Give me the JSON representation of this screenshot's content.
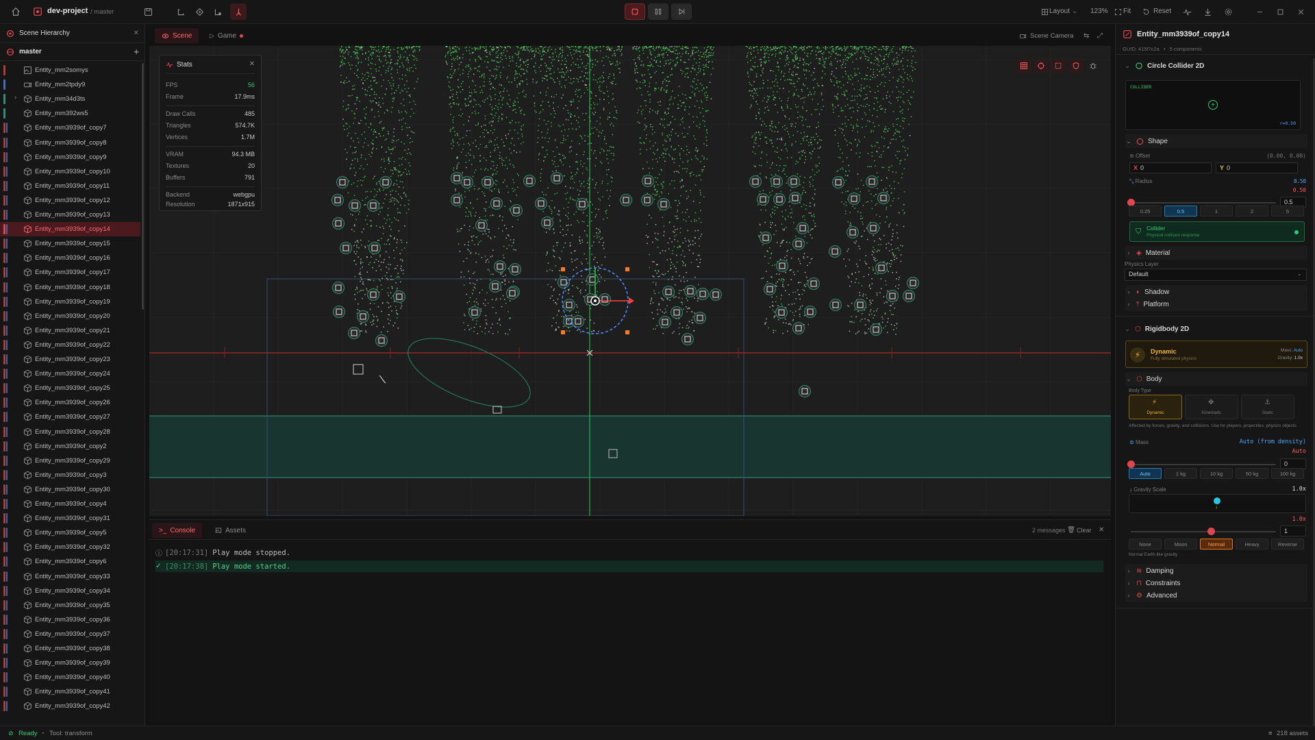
{
  "app": {
    "project": "dev-project",
    "branch": "/ master"
  },
  "toolbar": {
    "layout_label": "Layout",
    "zoom": "123%",
    "fit_label": "Fit",
    "reset_label": "Reset"
  },
  "hierarchy": {
    "title": "Scene Hierarchy",
    "root": "master",
    "items": [
      {
        "label": "Entity_mm2somys",
        "bar": "#b03a3a"
      },
      {
        "label": "Entity_mm2tpdy9",
        "bar": "#4a6fb0"
      },
      {
        "label": "Entity_mm34d3ts",
        "bar": "#2f8f7a"
      },
      {
        "label": "Entity_mm392ws5",
        "bar": "#2f8f7a"
      },
      {
        "label": "Entity_mm3939of_copy7",
        "bar": "#b03a3a"
      },
      {
        "label": "Entity_mm3939of_copy8",
        "bar": "#b03a3a"
      },
      {
        "label": "Entity_mm3939of_copy9",
        "bar": "#b03a3a"
      },
      {
        "label": "Entity_mm3939of_copy10",
        "bar": "#b03a3a"
      },
      {
        "label": "Entity_mm3939of_copy11",
        "bar": "#b03a3a"
      },
      {
        "label": "Entity_mm3939of_copy12",
        "bar": "#b03a3a"
      },
      {
        "label": "Entity_mm3939of_copy13",
        "bar": "#b03a3a"
      },
      {
        "label": "Entity_mm3939of_copy14",
        "bar": "#e0474c"
      },
      {
        "label": "Entity_mm3939of_copy15",
        "bar": "#b03a3a"
      },
      {
        "label": "Entity_mm3939of_copy16",
        "bar": "#b03a3a"
      },
      {
        "label": "Entity_mm3939of_copy17",
        "bar": "#b03a3a"
      },
      {
        "label": "Entity_mm3939of_copy18",
        "bar": "#b03a3a"
      },
      {
        "label": "Entity_mm3939of_copy19",
        "bar": "#b03a3a"
      },
      {
        "label": "Entity_mm3939of_copy20",
        "bar": "#b03a3a"
      },
      {
        "label": "Entity_mm3939of_copy21",
        "bar": "#b03a3a"
      },
      {
        "label": "Entity_mm3939of_copy22",
        "bar": "#b03a3a"
      },
      {
        "label": "Entity_mm3939of_copy23",
        "bar": "#b03a3a"
      },
      {
        "label": "Entity_mm3939of_copy24",
        "bar": "#b03a3a"
      },
      {
        "label": "Entity_mm3939of_copy25",
        "bar": "#b03a3a"
      },
      {
        "label": "Entity_mm3939of_copy26",
        "bar": "#b03a3a"
      },
      {
        "label": "Entity_mm3939of_copy27",
        "bar": "#b03a3a"
      },
      {
        "label": "Entity_mm3939of_copy28",
        "bar": "#b03a3a"
      },
      {
        "label": "Entity_mm3939of_copy2",
        "bar": "#b03a3a"
      },
      {
        "label": "Entity_mm3939of_copy29",
        "bar": "#b03a3a"
      },
      {
        "label": "Entity_mm3939of_copy3",
        "bar": "#b03a3a"
      },
      {
        "label": "Entity_mm3939of_copy30",
        "bar": "#b03a3a"
      },
      {
        "label": "Entity_mm3939of_copy4",
        "bar": "#b03a3a"
      },
      {
        "label": "Entity_mm3939of_copy31",
        "bar": "#b03a3a"
      },
      {
        "label": "Entity_mm3939of_copy5",
        "bar": "#b03a3a"
      },
      {
        "label": "Entity_mm3939of_copy32",
        "bar": "#b03a3a"
      },
      {
        "label": "Entity_mm3939of_copy6",
        "bar": "#b03a3a"
      },
      {
        "label": "Entity_mm3939of_copy33",
        "bar": "#b03a3a"
      },
      {
        "label": "Entity_mm3939of_copy34",
        "bar": "#b03a3a"
      },
      {
        "label": "Entity_mm3939of_copy35",
        "bar": "#b03a3a"
      },
      {
        "label": "Entity_mm3939of_copy36",
        "bar": "#b03a3a"
      },
      {
        "label": "Entity_mm3939of_copy37",
        "bar": "#b03a3a"
      },
      {
        "label": "Entity_mm3939of_copy38",
        "bar": "#b03a3a"
      },
      {
        "label": "Entity_mm3939of_copy39",
        "bar": "#b03a3a"
      },
      {
        "label": "Entity_mm3939of_copy40",
        "bar": "#b03a3a"
      },
      {
        "label": "Entity_mm3939of_copy41",
        "bar": "#b03a3a"
      },
      {
        "label": "Entity_mm3939of_copy42",
        "bar": "#b03a3a"
      }
    ]
  },
  "tabs": {
    "scene": "Scene",
    "game": "Game",
    "scene_camera": "Scene Camera"
  },
  "stats": {
    "title": "Stats",
    "rows": [
      {
        "label": "FPS",
        "value": "56"
      },
      {
        "label": "Frame",
        "value": "17.9ms"
      },
      {
        "label": "Draw Calls",
        "value": "485"
      },
      {
        "label": "Triangles",
        "value": "574.7K"
      },
      {
        "label": "Vertices",
        "value": "1.7M"
      },
      {
        "label": "VRAM",
        "value": "94.3 MB"
      },
      {
        "label": "Textures",
        "value": "20"
      },
      {
        "label": "Buffers",
        "value": "791"
      },
      {
        "label": "Backend",
        "value": "webgpu"
      },
      {
        "label": "Resolution",
        "value": "1871x915"
      }
    ]
  },
  "console": {
    "tab_console": "Console",
    "tab_assets": "Assets",
    "message_count": "2 messages",
    "clear_label": "Clear",
    "logs": [
      {
        "time": "[20:17:31]",
        "text": "Play mode stopped."
      },
      {
        "time": "[20:17:38]",
        "text": "Play mode started."
      }
    ]
  },
  "inspector": {
    "entity_name": "Entity_mm3939of_copy14",
    "guid": "GUID: 415f7c2a",
    "component_count": "5 components",
    "circle_collider": {
      "title": "Circle Collider 2D",
      "preview_label": "COLLIDER",
      "preview_radius": "r=0.50",
      "shape_label": "Shape",
      "offset_label": "Offset",
      "offset_value": "(0.00, 0.00)",
      "x_value": "0",
      "y_value": "0",
      "radius_label": "Radius",
      "radius_value": "0.50",
      "radius_badge": "0.50",
      "radius_input": "0.5",
      "radius_fraction": 0.0,
      "presets": [
        "0.25",
        "0.5",
        "1",
        "2",
        "5"
      ],
      "collider_title": "Collider",
      "collider_sub": "Physical collision response",
      "material_label": "Material",
      "physics_layer_label": "Physics Layer",
      "physics_layer_value": "Default",
      "shadow_label": "Shadow",
      "platform_label": "Platform"
    },
    "rigidbody": {
      "title": "Rigidbody 2D",
      "dynamic_title": "Dynamic",
      "dynamic_sub": "Fully simulated physics",
      "mass_key": "Mass:",
      "mass_val": "Auto",
      "gravity_key": "Gravity:",
      "gravity_val": "1.0x",
      "body_label": "Body",
      "body_type_label": "Body Type",
      "body_types": [
        "Dynamic",
        "Kinematic",
        "Static"
      ],
      "body_desc": "Affected by forces, gravity, and collisions. Use for players, projectiles, physics objects",
      "mass_label": "Mass",
      "mass_value": "Auto (from density)",
      "mass_badge": "Auto",
      "mass_input": "0",
      "mass_fraction": 0.0,
      "mass_presets": [
        "Auto",
        "1 kg",
        "10 kg",
        "50 kg",
        "100 kg"
      ],
      "gravity_scale_label": "Gravity Scale",
      "gravity_scale_value": "1.0x",
      "gravity_badge": "1.0x",
      "gravity_input": "1",
      "gravity_fraction": 0.55,
      "gravity_presets": [
        "None",
        "Moon",
        "Normal",
        "Heavy",
        "Reverse"
      ],
      "gravity_desc": "Normal Earth-like gravity",
      "damping_label": "Damping",
      "constraints_label": "Constraints",
      "advanced_label": "Advanced"
    }
  },
  "status": {
    "ready": "Ready",
    "tool": "Tool: transform",
    "assets": "218 assets"
  },
  "colors": {
    "accent": "#e0474c",
    "green": "#2ecc71",
    "teal": "#1f5c50",
    "amber": "#f0b429"
  }
}
